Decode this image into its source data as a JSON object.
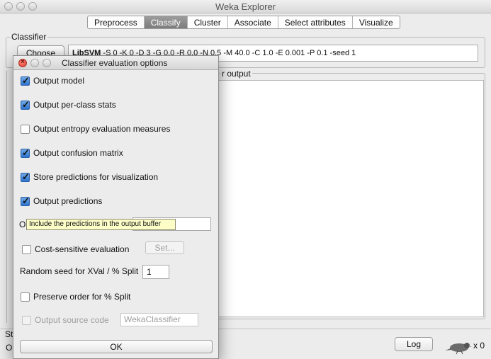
{
  "window": {
    "title": "Weka Explorer"
  },
  "tabs": [
    {
      "label": "Preprocess",
      "active": false
    },
    {
      "label": "Classify",
      "active": true
    },
    {
      "label": "Cluster",
      "active": false
    },
    {
      "label": "Associate",
      "active": false
    },
    {
      "label": "Select attributes",
      "active": false
    },
    {
      "label": "Visualize",
      "active": false
    }
  ],
  "classifier": {
    "group_label": "Classifier",
    "choose_label": "Choose",
    "name": "LibSVM",
    "options": "-S 0 -K 0 -D 3 -G 0.0 -R 0.0 -N 0.5 -M 40.0 -C 1.0 -E 0.001 -P 0.1 -seed 1"
  },
  "output_panel": {
    "label": "r output"
  },
  "status": {
    "label_fragment": "St",
    "text_fragment": "O",
    "log_label": "Log",
    "count": "x 0"
  },
  "dialog": {
    "title": "Classifier evaluation options",
    "options": [
      {
        "label": "Output model",
        "checked": true
      },
      {
        "label": "Output per-class stats",
        "checked": true
      },
      {
        "label": "Output entropy evaluation measures",
        "checked": false
      },
      {
        "label": "Output confusion matrix",
        "checked": true
      },
      {
        "label": "Store predictions for visualization",
        "checked": true
      },
      {
        "label": "Output predictions",
        "checked": true
      }
    ],
    "output_predictions_field_label": "O",
    "tooltip": "Include the predictions in the output buffer",
    "cost_sensitive_label": "Cost-sensitive evaluation",
    "set_label": "Set...",
    "seed_label": "Random seed for XVal / % Split",
    "seed_value": "1",
    "preserve_order_label": "Preserve order for % Split",
    "output_source_label": "Output source code",
    "source_class_name": "WekaClassifier",
    "ok_label": "OK"
  },
  "colors": {
    "checkbox_accent": "#2d74d0",
    "tooltip_bg": "#fdfdc8",
    "close_red": "#d8392b"
  }
}
